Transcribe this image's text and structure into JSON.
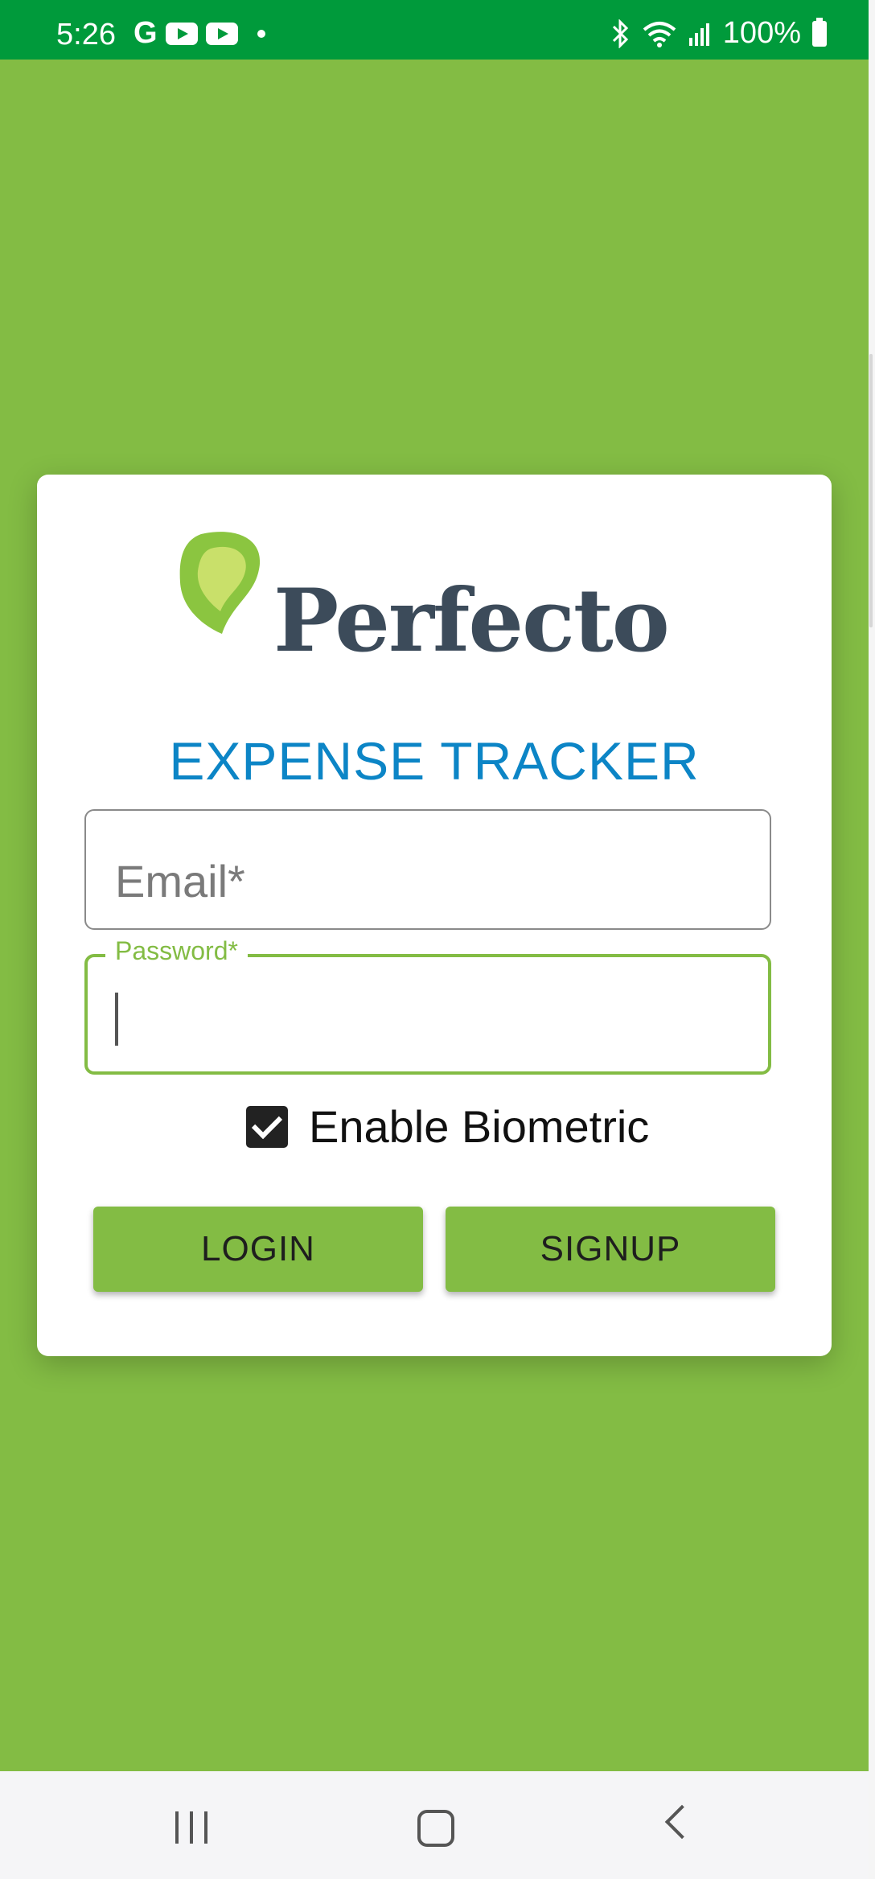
{
  "status_bar": {
    "time": "5:26",
    "google_glyph": "G",
    "battery": "100%",
    "icons_left": [
      "google-icon",
      "youtube-icon",
      "youtube-icon",
      "dot-icon"
    ],
    "icons_right": [
      "bluetooth-icon",
      "wifi-icon",
      "signal-icon",
      "battery-icon"
    ]
  },
  "colors": {
    "background": "#83bc44",
    "status_bar": "#009a3b",
    "title": "#0c85c6",
    "accent": "#83bc44"
  },
  "logo": {
    "text": "Perfecto"
  },
  "title": "EXPENSE TRACKER",
  "form": {
    "email_placeholder": "Email*",
    "password_label": "Password*",
    "password_value": "",
    "biometric_label": "Enable Biometric",
    "biometric_checked": true
  },
  "buttons": {
    "login": "LOGIN",
    "signup": "SIGNUP"
  },
  "nav": {
    "icons": [
      "recent-apps-icon",
      "home-icon",
      "back-icon"
    ]
  }
}
